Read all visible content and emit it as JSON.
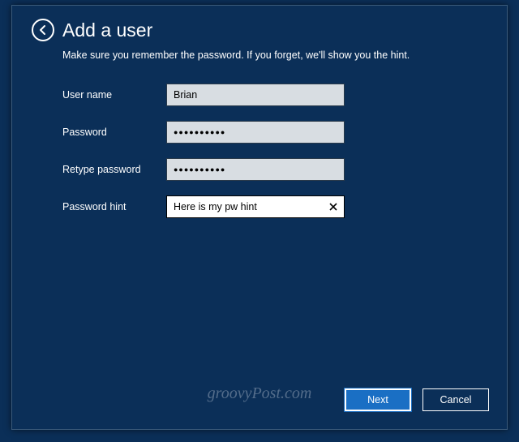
{
  "header": {
    "title": "Add a user",
    "subtitle": "Make sure you remember the password. If you forget, we'll show you the hint."
  },
  "form": {
    "username": {
      "label": "User name",
      "value": "Brian"
    },
    "password": {
      "label": "Password",
      "value": "●●●●●●●●●●"
    },
    "retype": {
      "label": "Retype password",
      "value": "●●●●●●●●●●"
    },
    "hint": {
      "label": "Password hint",
      "value": "Here is my pw hint"
    }
  },
  "buttons": {
    "next": "Next",
    "cancel": "Cancel"
  },
  "watermark": "groovyPost.com"
}
